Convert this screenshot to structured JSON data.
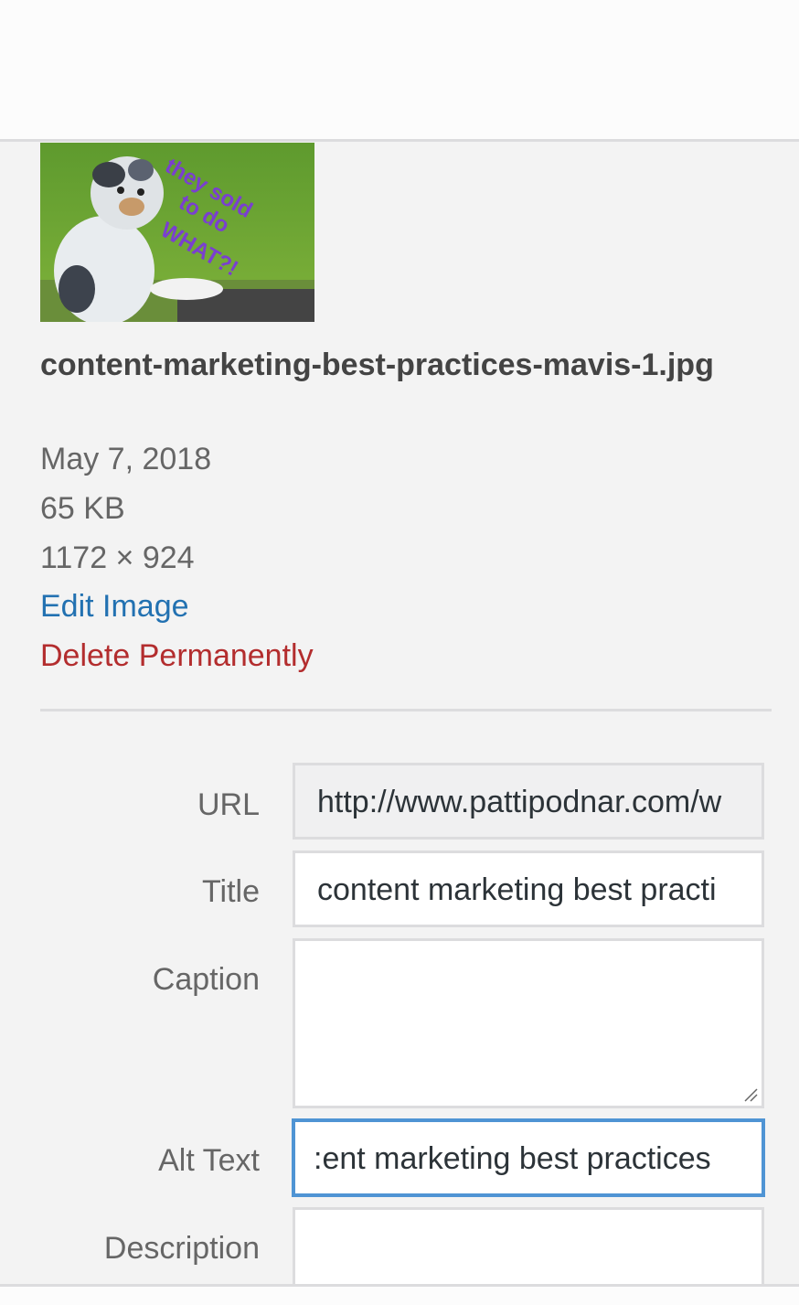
{
  "attachment": {
    "filename": "content-marketing-best-practices-mavis-1.jpg",
    "date": "May 7, 2018",
    "filesize": "65 KB",
    "dimensions": "1172 × 924",
    "thumbnail_text": "they sold to do WHAT?!"
  },
  "actions": {
    "edit_image": "Edit Image",
    "delete_permanently": "Delete Permanently"
  },
  "fields": {
    "url": {
      "label": "URL",
      "value": "http://www.pattipodnar.com/w"
    },
    "title": {
      "label": "Title",
      "value": "content marketing best practi"
    },
    "caption": {
      "label": "Caption",
      "value": ""
    },
    "alt_text": {
      "label": "Alt Text",
      "value": ":ent marketing best practices"
    },
    "description": {
      "label": "Description",
      "value": ""
    }
  },
  "colors": {
    "link": "#2271b1",
    "delete": "#b32d2e",
    "focus": "#4f94d4"
  }
}
